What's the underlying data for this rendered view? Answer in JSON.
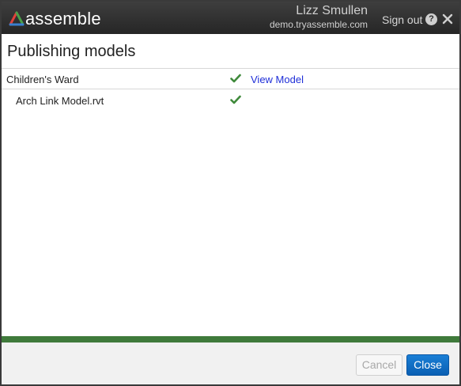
{
  "app": {
    "logo_text": "assemble"
  },
  "header": {
    "user_name": "Lizz Smullen",
    "domain": "demo.tryassemble.com",
    "signout_label": "Sign out",
    "help_icon": "?"
  },
  "main": {
    "title": "Publishing models",
    "rows": [
      {
        "name": "Children's Ward",
        "status": "published",
        "link_label": "View Model"
      },
      {
        "name": "Arch Link Model.rvt",
        "status": "published"
      }
    ]
  },
  "footer": {
    "cancel_label": "Cancel",
    "close_label": "Close",
    "progress_percent": 100
  },
  "colors": {
    "progress": "#3f7a3b",
    "link": "#1f2fd8",
    "primary_button": "#0a6cc6",
    "check": "#3f8a3b"
  },
  "icons": [
    "assemble-logo-icon",
    "help-icon",
    "close-icon",
    "check-icon"
  ]
}
